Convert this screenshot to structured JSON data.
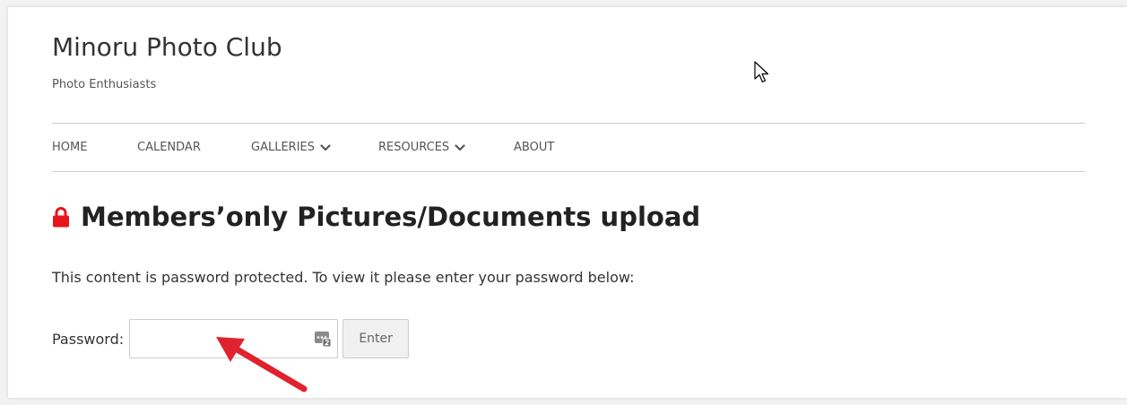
{
  "site": {
    "title": "Minoru Photo Club",
    "tagline": "Photo Enthusiasts"
  },
  "nav": {
    "items": [
      {
        "label": "HOME",
        "has_dropdown": false
      },
      {
        "label": "CALENDAR",
        "has_dropdown": false
      },
      {
        "label": "GALLERIES",
        "has_dropdown": true
      },
      {
        "label": "RESOURCES",
        "has_dropdown": true
      },
      {
        "label": "ABOUT",
        "has_dropdown": false
      }
    ]
  },
  "content": {
    "heading": "Members’only Pictures/Documents upload",
    "heading_icon": "lock-icon",
    "description": "This content is password protected. To view it please enter your password below:",
    "password_label": "Password:",
    "password_value": "",
    "password_placeholder": "",
    "enter_label": "Enter"
  },
  "icons": {
    "lock": "lock-icon",
    "chevron": "chevron-down-icon",
    "password_manager": "password-manager-icon",
    "cursor": "mouse-cursor-icon",
    "annotation": "red-arrow-annotation"
  },
  "colors": {
    "lock": "#e8141c",
    "arrow": "#e0222e",
    "text": "#333333",
    "nav_text": "#555555",
    "border": "#cccccc",
    "button_bg": "#f0f0f0"
  }
}
